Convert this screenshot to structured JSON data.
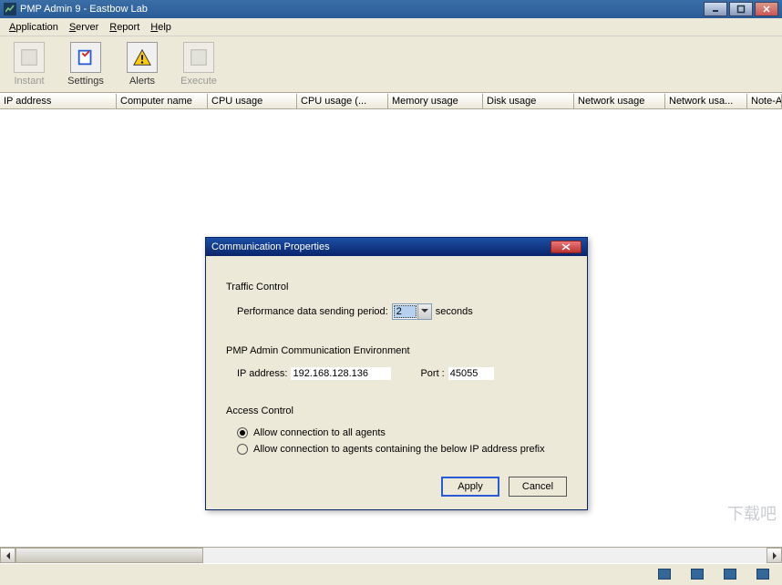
{
  "window": {
    "title": "PMP Admin 9 - Eastbow Lab"
  },
  "menu": {
    "application": "Application",
    "server": "Server",
    "report": "Report",
    "help": "Help"
  },
  "toolbar": {
    "instant": "Instant",
    "settings": "Settings",
    "alerts": "Alerts",
    "execute": "Execute"
  },
  "columns": {
    "ip": "IP address",
    "computer": "Computer name",
    "cpu": "CPU usage",
    "cpu2": "CPU usage (...",
    "memory": "Memory usage",
    "disk": "Disk usage",
    "network": "Network usage",
    "network2": "Network usa...",
    "note": "Note-A"
  },
  "dialog": {
    "title": "Communication Properties",
    "traffic": {
      "heading": "Traffic Control",
      "period_label": "Performance data sending period:",
      "period_value": "2",
      "seconds": "seconds"
    },
    "env": {
      "heading": "PMP Admin Communication Environment",
      "ip_label": "IP address:",
      "ip_value": "192.168.128.136",
      "port_label": "Port :",
      "port_value": "45055"
    },
    "access": {
      "heading": "Access Control",
      "opt_all": "Allow connection to all agents",
      "opt_prefix": "Allow connection to agents containing the below IP address prefix"
    },
    "buttons": {
      "apply": "Apply",
      "cancel": "Cancel"
    }
  },
  "watermark": "下载吧"
}
